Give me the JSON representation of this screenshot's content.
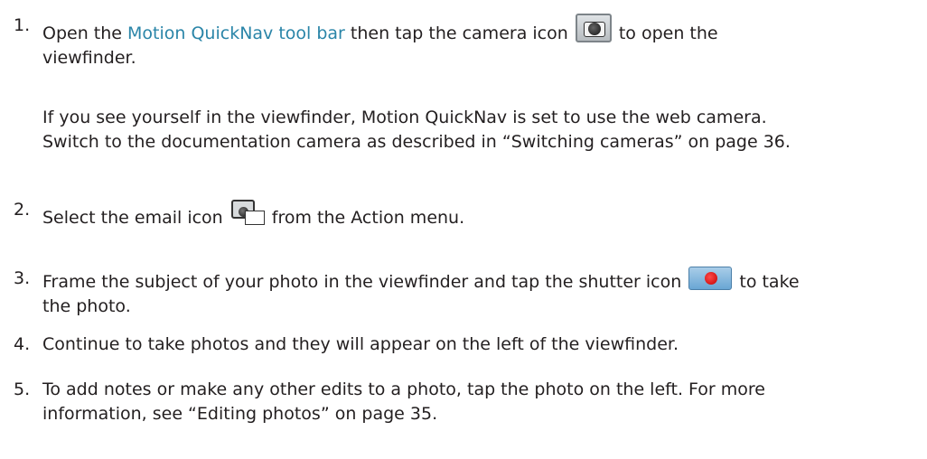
{
  "steps": [
    {
      "number": "1.",
      "before": "Open the ",
      "link": "Motion QuickNav tool bar",
      "middle": " then tap the camera icon ",
      "after_line1": " to open the",
      "line2": "viewfinder.",
      "note_line1": "If you see yourself in the viewfinder, Motion QuickNav is set to use the web camera.",
      "note_line2": "Switch to the documentation camera as described in “Switching cameras” on page 36.",
      "icon": "camera-icon"
    },
    {
      "number": "2.",
      "before": "Select the email icon ",
      "after": " from the Action menu.",
      "icon": "camera-email-icon"
    },
    {
      "number": "3.",
      "before": "Frame the subject of your photo in the viewfinder and tap the shutter icon ",
      "after_line1": " to take",
      "line2": "the photo.",
      "icon": "shutter-icon"
    },
    {
      "number": "4.",
      "text": "Continue to take photos and they will appear on the left of the viewfinder."
    },
    {
      "number": "5.",
      "line1": "To add notes or make any other edits to a photo, tap the photo on the left. For more",
      "line2": "information, see “Editing photos” on page 35."
    }
  ]
}
